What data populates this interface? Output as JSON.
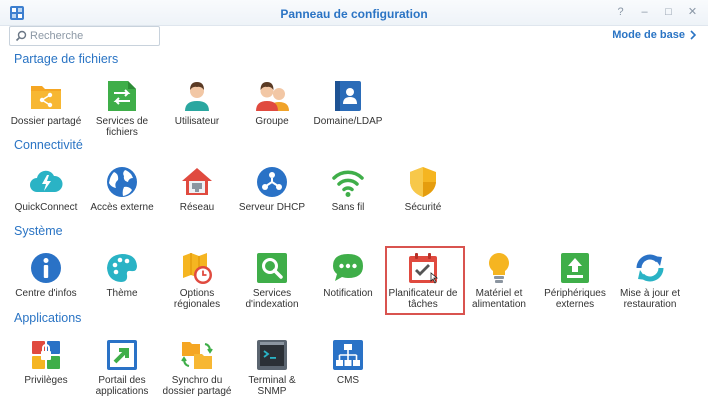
{
  "window": {
    "title": "Panneau de configuration",
    "controls": {
      "help": "?",
      "minimize": "–",
      "maximize": "□",
      "close": "✕"
    }
  },
  "search": {
    "placeholder": "Recherche",
    "value": ""
  },
  "mode_link": "Mode de base",
  "sections": [
    {
      "title": "Partage de fichiers",
      "items": [
        {
          "label": "Dossier partagé",
          "icon": "shared-folder-icon"
        },
        {
          "label": "Services de fichiers",
          "icon": "file-services-icon"
        },
        {
          "label": "Utilisateur",
          "icon": "user-icon"
        },
        {
          "label": "Groupe",
          "icon": "group-icon"
        },
        {
          "label": "Domaine/LDAP",
          "icon": "domain-ldap-icon"
        }
      ]
    },
    {
      "title": "Connectivité",
      "items": [
        {
          "label": "QuickConnect",
          "icon": "quickconnect-icon"
        },
        {
          "label": "Accès externe",
          "icon": "external-access-icon"
        },
        {
          "label": "Réseau",
          "icon": "network-icon"
        },
        {
          "label": "Serveur DHCP",
          "icon": "dhcp-server-icon"
        },
        {
          "label": "Sans fil",
          "icon": "wireless-icon"
        },
        {
          "label": "Sécurité",
          "icon": "security-icon"
        }
      ]
    },
    {
      "title": "Système",
      "items": [
        {
          "label": "Centre d'infos",
          "icon": "info-center-icon"
        },
        {
          "label": "Thème",
          "icon": "theme-icon"
        },
        {
          "label": "Options régionales",
          "icon": "regional-options-icon"
        },
        {
          "label": "Services d'indexation",
          "icon": "indexing-service-icon"
        },
        {
          "label": "Notification",
          "icon": "notification-icon"
        },
        {
          "label": "Planificateur de tâches",
          "icon": "task-scheduler-icon"
        },
        {
          "label": "Matériel et alimentation",
          "icon": "hardware-power-icon"
        },
        {
          "label": "Périphériques externes",
          "icon": "external-devices-icon"
        },
        {
          "label": "Mise à jour et restauration",
          "icon": "update-restore-icon"
        }
      ]
    },
    {
      "title": "Applications",
      "items": [
        {
          "label": "Privilèges",
          "icon": "privileges-icon"
        },
        {
          "label": "Portail des applications",
          "icon": "application-portal-icon"
        },
        {
          "label": "Synchro du dossier partagé",
          "icon": "shared-folder-sync-icon"
        },
        {
          "label": "Terminal & SNMP",
          "icon": "terminal-snmp-icon"
        },
        {
          "label": "CMS",
          "icon": "cms-icon"
        }
      ]
    }
  ],
  "colors": {
    "accent": "#2a74c4",
    "highlight": "#d9534f"
  }
}
